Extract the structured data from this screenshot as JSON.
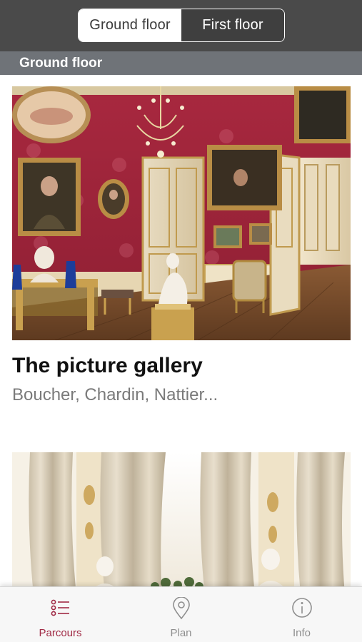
{
  "segmented_control": {
    "options": [
      {
        "label": "Ground floor",
        "selected": true
      },
      {
        "label": "First floor",
        "selected": false
      }
    ]
  },
  "section": {
    "title": "Ground floor"
  },
  "cards": [
    {
      "title": "The picture gallery",
      "subtitle": "Boucher, Chardin, Nattier...",
      "image": "red-damask-gallery-room-photo"
    },
    {
      "image": "white-salon-curtains-photo"
    }
  ],
  "tabbar": {
    "tabs": [
      {
        "label": "Parcours",
        "icon": "list-icon",
        "active": true
      },
      {
        "label": "Plan",
        "icon": "map-pin-icon",
        "active": false
      },
      {
        "label": "Info",
        "icon": "info-icon",
        "active": false
      }
    ]
  },
  "colors": {
    "topbar": "#4a4a4a",
    "section_header": "#6f7378",
    "accent": "#a02a45",
    "tab_inactive": "#8e8e8e"
  }
}
